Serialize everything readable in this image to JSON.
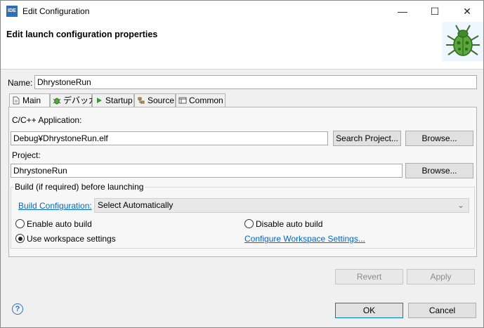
{
  "window": {
    "app_icon_text": "IDE",
    "title": "Edit Configuration",
    "minimize_glyph": "—",
    "maximize_glyph": "☐",
    "close_glyph": "✕"
  },
  "header": {
    "title": "Edit launch configuration properties",
    "banner_icon": "bug-icon"
  },
  "name_field": {
    "label": "Name:",
    "value": "DhrystoneRun"
  },
  "tabs": [
    {
      "label": "Main",
      "icon": "document-icon",
      "active": true
    },
    {
      "label": "デバッガ",
      "icon": "bug-small-icon",
      "active": false
    },
    {
      "label": "Startup",
      "icon": "play-icon",
      "active": false
    },
    {
      "label": "Source",
      "icon": "source-icon",
      "active": false
    },
    {
      "label": "Common",
      "icon": "common-icon",
      "active": false
    }
  ],
  "main": {
    "app_label": "C/C++ Application:",
    "app_value": "Debug¥DhrystoneRun.elf",
    "search_project_button": "Search Project...",
    "browse_button_1": "Browse...",
    "project_label": "Project:",
    "project_value": "DhrystoneRun",
    "browse_button_2": "Browse...",
    "build_group_label": "Build (if required) before launching",
    "build_config_link": "Build Configuration:",
    "build_config_select": "Select Automatically",
    "enable_auto_build": "Enable auto build",
    "disable_auto_build": "Disable auto build",
    "use_workspace_settings": "Use workspace settings",
    "configure_workspace_link": "Configure Workspace Settings...",
    "selected_radio": "use_workspace_settings"
  },
  "actions": {
    "revert": "Revert",
    "apply": "Apply",
    "ok": "OK",
    "cancel": "Cancel",
    "help_glyph": "?"
  },
  "colors": {
    "link": "#0066cc",
    "accent": "#2f6fb8"
  }
}
